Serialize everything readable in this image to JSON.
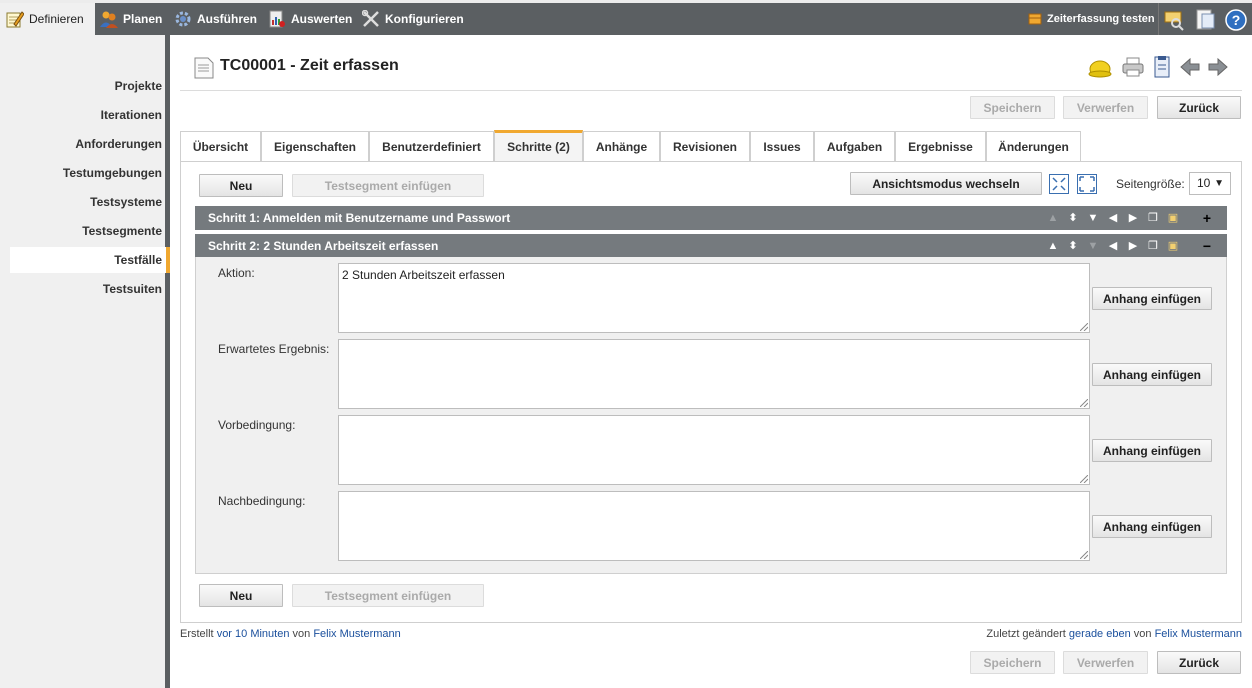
{
  "nav": {
    "definieren": "Definieren",
    "planen": "Planen",
    "ausfuehren": "Ausführen",
    "auswerten": "Auswerten",
    "konfigurieren": "Konfigurieren",
    "zeiterfassung": "Zeiterfassung testen"
  },
  "sidebar": {
    "items": [
      "Projekte",
      "Iterationen",
      "Anforderungen",
      "Testumgebungen",
      "Testsysteme",
      "Testsegmente",
      "Testfälle",
      "Testsuiten"
    ]
  },
  "header": {
    "title": "TC00001 - Zeit erfassen"
  },
  "actions": {
    "speichern": "Speichern",
    "verwerfen": "Verwerfen",
    "zurueck": "Zurück"
  },
  "tabs": [
    "Übersicht",
    "Eigenschaften",
    "Benutzerdefiniert",
    "Schritte (2)",
    "Anhänge",
    "Revisionen",
    "Issues",
    "Aufgaben",
    "Ergebnisse",
    "Änderungen"
  ],
  "toolbar": {
    "neu": "Neu",
    "testsegment": "Testsegment einfügen",
    "ansichtsmodus": "Ansichtsmodus wechseln",
    "seitengroesse_label": "Seitengröße:",
    "seitengroesse_value": "10"
  },
  "steps": [
    {
      "title": "Schritt 1: Anmelden mit Benutzername und Passwort",
      "toggle": "+"
    },
    {
      "title": "Schritt 2: 2 Stunden Arbeitszeit erfassen",
      "toggle": "−"
    }
  ],
  "fields": {
    "aktion_label": "Aktion:",
    "aktion_value": "2 Stunden Arbeitszeit erfassen",
    "erwartet_label": "Erwartetes Ergebnis:",
    "vorbedingung_label": "Vorbedingung:",
    "nachbedingung_label": "Nachbedingung:",
    "anhang": "Anhang einfügen"
  },
  "footer": {
    "erstellt": "Erstellt",
    "erstellt_when": "vor 10 Minuten",
    "von": "von",
    "erstellt_by": "Felix Mustermann",
    "geaendert": "Zuletzt geändert",
    "geaendert_when": "gerade eben",
    "geaendert_by": "Felix Mustermann"
  },
  "colors": {
    "accent": "#f0a830",
    "chrome": "#5b5f62",
    "stepbar": "#757a7e"
  }
}
